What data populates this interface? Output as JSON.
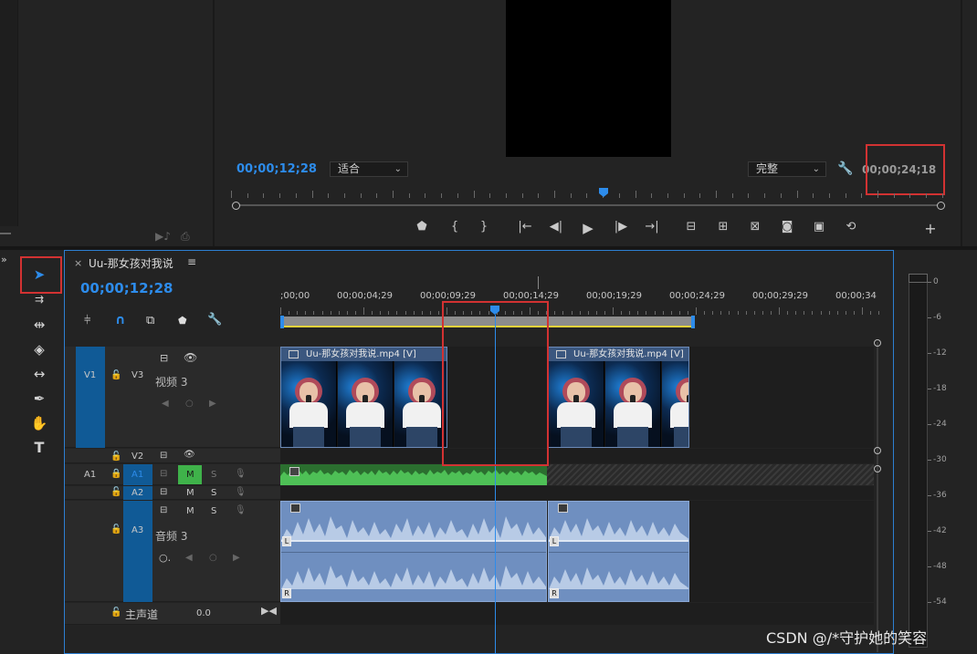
{
  "program_monitor": {
    "current_timecode": "00;00;12;28",
    "fit_dropdown": "适合",
    "quality_dropdown": "完整",
    "duration_timecode": "00;00;24;18"
  },
  "sequence": {
    "close_symbol": "×",
    "tab_name": "Uu-那女孩对我说",
    "menu_symbol": "≡",
    "current_timecode": "00;00;12;28",
    "ruler_labels": [
      ";00;00",
      "00;00;04;29",
      "00;00;09;29",
      "00;00;14;29",
      "00;00;19;29",
      "00;00;24;29",
      "00;00;29;29",
      "00;00;34"
    ]
  },
  "tracks": {
    "v1": "V1",
    "v3": "V3",
    "v3_name": "视频 3",
    "v2": "V2",
    "a1_source": "A1",
    "a1": "A1",
    "a2": "A2",
    "a3": "A3",
    "a3_name": "音频 3",
    "mute": "M",
    "solo": "S",
    "master_label": "主声道",
    "master_value": "0.0"
  },
  "clips": {
    "clip1_label": "Uu-那女孩对我说.mp4 [V]",
    "clip2_label": "Uu-那女孩对我说.mp4 [V]",
    "left_channel": "L",
    "right_channel": "R"
  },
  "meter": {
    "scale": [
      "0",
      "-6",
      "-12",
      "-18",
      "-24",
      "-30",
      "-36",
      "-42",
      "-48",
      "-54"
    ]
  },
  "watermark": "CSDN @/*守护她的笑容",
  "colors": {
    "accent_blue": "#2d8ceb",
    "highlight_red": "#d23232",
    "audio_green": "#3fb24a",
    "clip_blue": "#6f8fc0"
  }
}
